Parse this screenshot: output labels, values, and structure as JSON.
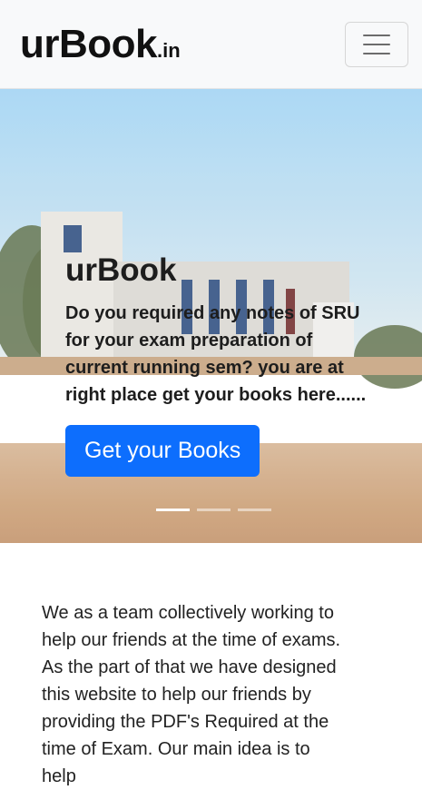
{
  "navbar": {
    "brand_main": "urBook",
    "brand_suffix": ".in",
    "toggler_icon": "hamburger-icon"
  },
  "carousel": {
    "title": "urBook",
    "text": "Do you required any notes of SRU for your exam preparation of current running sem? you are at right place get your books here......",
    "button_label": "Get your Books",
    "button_color": "#0d6efd",
    "slides_count": 3,
    "active_slide": 1,
    "prev_icon": "chevron-left-icon",
    "next_icon": "chevron-right-icon"
  },
  "about": {
    "text": "We as a team collectively working to help our friends at the time of exams. As the part of that we have designed this website to help our friends by providing the PDF's Required at the time of Exam. Our main idea is to help"
  }
}
